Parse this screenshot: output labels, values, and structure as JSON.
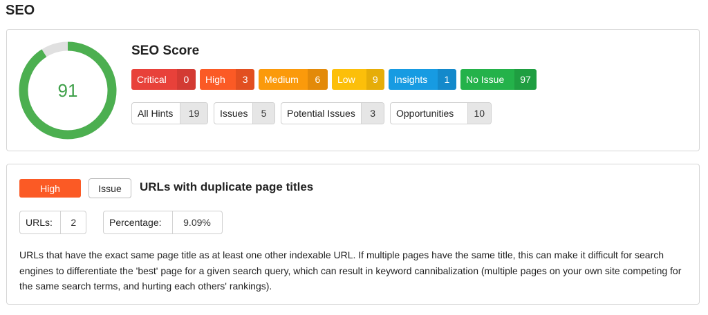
{
  "page": {
    "title": "SEO"
  },
  "score": {
    "title": "SEO Score",
    "value": 91,
    "fraction": 0.91,
    "ring_color": "#4caf50",
    "track_color": "#e0e0e0"
  },
  "severities": [
    {
      "label": "Critical",
      "count": "0",
      "color": "#e8413a",
      "count_color": "#d33a33"
    },
    {
      "label": "High",
      "count": "3",
      "color": "#fb5a25",
      "count_color": "#e24f20"
    },
    {
      "label": "Medium",
      "count": "6",
      "color": "#fb9a0b",
      "count_color": "#e38a09"
    },
    {
      "label": "Low",
      "count": "9",
      "color": "#fcbf0a",
      "count_color": "#e6ad08"
    },
    {
      "label": "Insights",
      "count": "1",
      "color": "#179be2",
      "count_color": "#1389cb"
    },
    {
      "label": "No Issue",
      "count": "97",
      "color": "#24b24a",
      "count_color": "#1f9e41"
    }
  ],
  "hints": [
    {
      "label": "All Hints",
      "count": "19"
    },
    {
      "label": "Issues",
      "count": "5"
    },
    {
      "label": "Potential Issues",
      "count": "3"
    },
    {
      "label": "Opportunities",
      "count": "10"
    }
  ],
  "issue": {
    "priority": "High",
    "type": "Issue",
    "title": "URLs with duplicate page titles",
    "urls_label": "URLs:",
    "urls_value": "2",
    "percentage_label": "Percentage:",
    "percentage_value": "9.09%",
    "description": "URLs that have the exact same page title as at least one other indexable URL. If multiple pages have the same title, this can make it difficult for search engines to differentiate the 'best' page for a given search query, which can result in keyword cannibalization (multiple pages on your own site competing for the same search terms, and hurting each others' rankings)."
  }
}
